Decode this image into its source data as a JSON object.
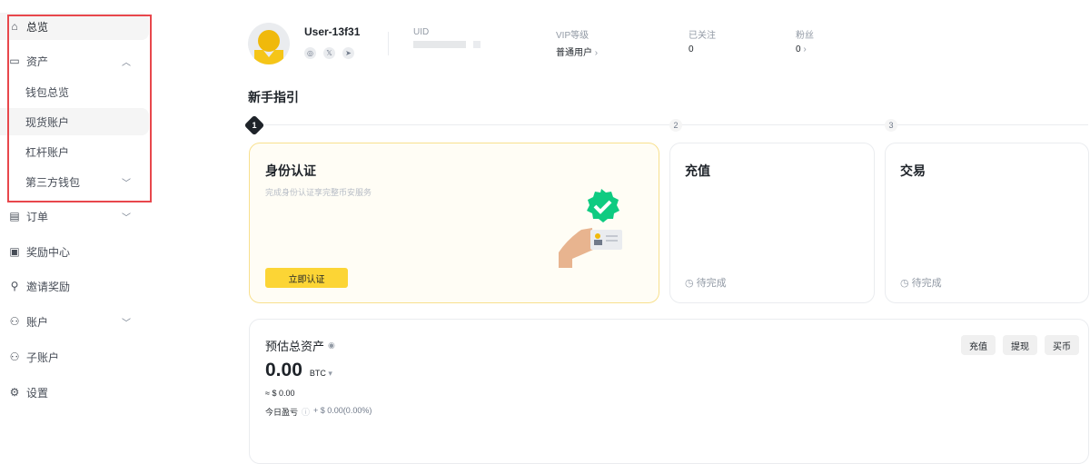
{
  "sidebar": {
    "items": [
      {
        "label": "总览",
        "icon": "home-icon"
      },
      {
        "label": "资产",
        "icon": "wallet-icon"
      },
      {
        "label": "钱包总览"
      },
      {
        "label": "现货账户"
      },
      {
        "label": "杠杆账户"
      },
      {
        "label": "第三方钱包"
      },
      {
        "label": "订单",
        "icon": "order-icon"
      },
      {
        "label": "奖励中心",
        "icon": "reward-icon"
      },
      {
        "label": "邀请奖励",
        "icon": "invite-icon"
      },
      {
        "label": "账户",
        "icon": "user-icon"
      },
      {
        "label": "子账户",
        "icon": "sub-account-icon"
      },
      {
        "label": "设置",
        "icon": "settings-icon"
      }
    ]
  },
  "profile": {
    "username": "User-13f31",
    "uid_label": "UID",
    "vip_label": "VIP等级",
    "vip_value": "普通用户",
    "following_label": "已关注",
    "following_value": "0",
    "followers_label": "粉丝",
    "followers_value": "0"
  },
  "guide": {
    "title": "新手指引",
    "steps": [
      {
        "num": "1",
        "title": "身份认证",
        "desc": "完成身份认证享完整币安服务",
        "button": "立即认证"
      },
      {
        "num": "2",
        "title": "充值",
        "status": "待完成"
      },
      {
        "num": "3",
        "title": "交易",
        "status": "待完成"
      }
    ]
  },
  "assets": {
    "title": "预估总资产",
    "amount": "0.00",
    "currency": "BTC",
    "usd": "≈ $ 0.00",
    "pnl_label": "今日盈亏",
    "pnl_value": "+ $ 0.00(0.00%)",
    "buttons": [
      "充值",
      "提现",
      "买币"
    ]
  },
  "colors": {
    "accent": "#fcd535",
    "highlight_border": "#e8474c",
    "success": "#0ecb81"
  }
}
